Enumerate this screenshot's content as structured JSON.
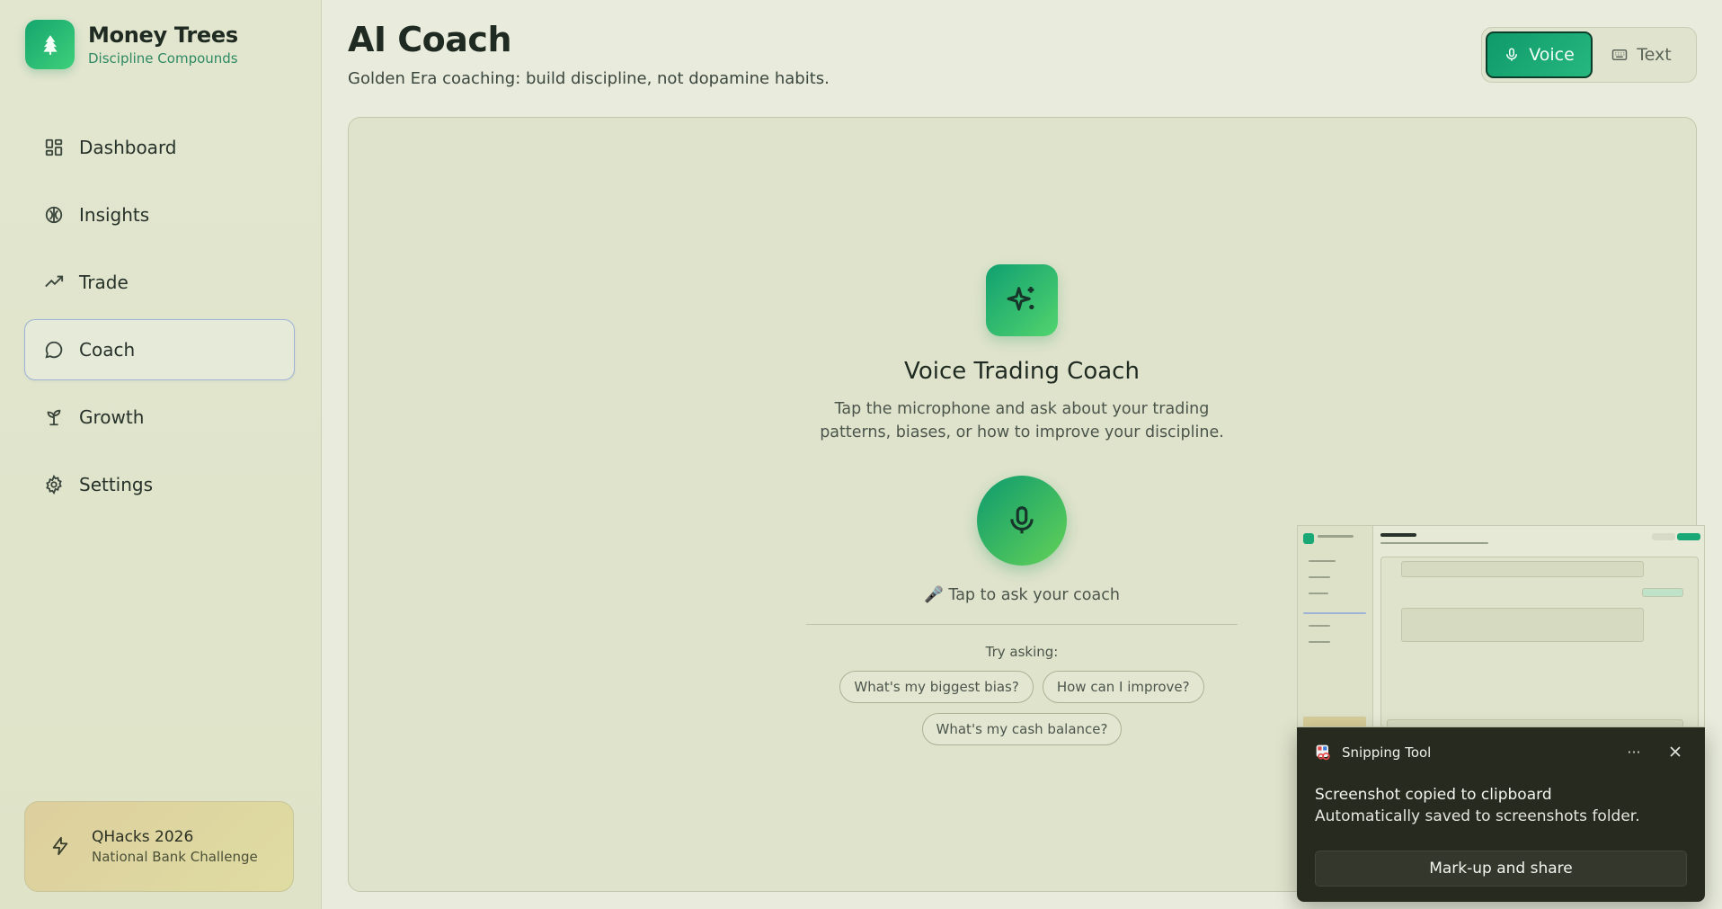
{
  "brand": {
    "title": "Money Trees",
    "subtitle": "Discipline Compounds",
    "logo_icon": "tree-icon"
  },
  "sidebar": {
    "items": [
      {
        "label": "Dashboard",
        "icon": "dashboard-grid-icon",
        "active": false
      },
      {
        "label": "Insights",
        "icon": "brain-icon",
        "active": false
      },
      {
        "label": "Trade",
        "icon": "trending-up-icon",
        "active": false
      },
      {
        "label": "Coach",
        "icon": "chat-bubble-icon",
        "active": true
      },
      {
        "label": "Growth",
        "icon": "sprout-icon",
        "active": false
      },
      {
        "label": "Settings",
        "icon": "gear-icon",
        "active": false
      }
    ],
    "promo": {
      "title": "QHacks 2026",
      "subtitle": "National Bank Challenge",
      "icon": "lightning-icon"
    }
  },
  "header": {
    "title": "AI Coach",
    "subtitle": "Golden Era coaching: build discipline, not dopamine habits."
  },
  "mode_toggle": {
    "voice_label": "Voice",
    "text_label": "Text",
    "selected": "Voice"
  },
  "coach": {
    "title": "Voice Trading Coach",
    "description": "Tap the microphone and ask about your trading patterns, biases, or how to improve your discipline.",
    "tap_hint": "🎤 Tap to ask your coach",
    "try_label": "Try asking:",
    "suggestions": [
      "What's my biggest bias?",
      "How can I improve?",
      "What's my cash balance?"
    ]
  },
  "notification": {
    "app_name": "Snipping Tool",
    "more_label": "···",
    "title": "Screenshot copied to clipboard",
    "body": "Automatically saved to screenshots folder.",
    "action_label": "Mark-up and share"
  },
  "colors": {
    "accent": "#14a56f",
    "background": "#e9ecdc",
    "toast_background": "#262a1f"
  }
}
